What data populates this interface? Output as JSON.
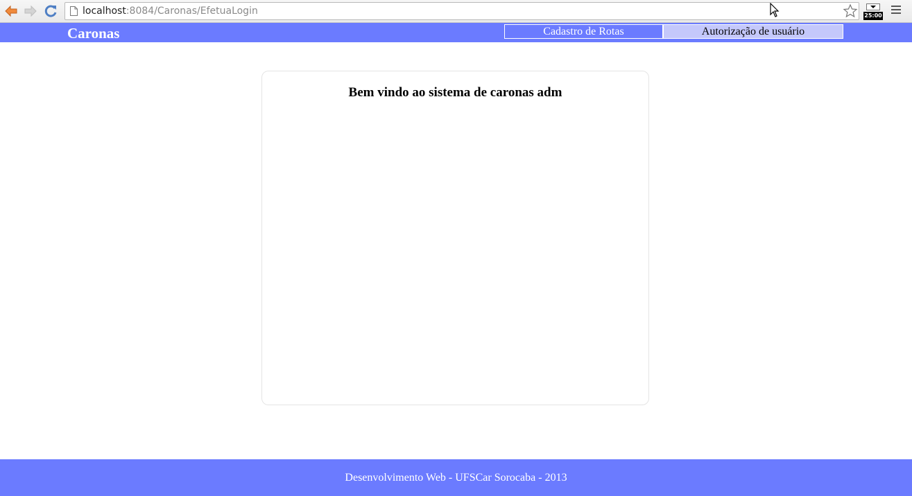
{
  "browser": {
    "url_host": "localhost",
    "url_rest": ":8084/Caronas/EfetuaLogin",
    "extension_timer": "25:00"
  },
  "header": {
    "brand": "Caronas",
    "nav": [
      {
        "label": "Cadastro de Rotas"
      },
      {
        "label": "Autorização de usuário"
      }
    ]
  },
  "main": {
    "welcome": "Bem vindo ao sistema de caronas adm"
  },
  "footer": {
    "text": "Desenvolvimento Web - UFSCar Sorocaba - 2013"
  },
  "colors": {
    "header_bg": "#6b7bff",
    "active_tab_bg": "#c4c8fb",
    "footer_bg": "#6b7bff"
  }
}
